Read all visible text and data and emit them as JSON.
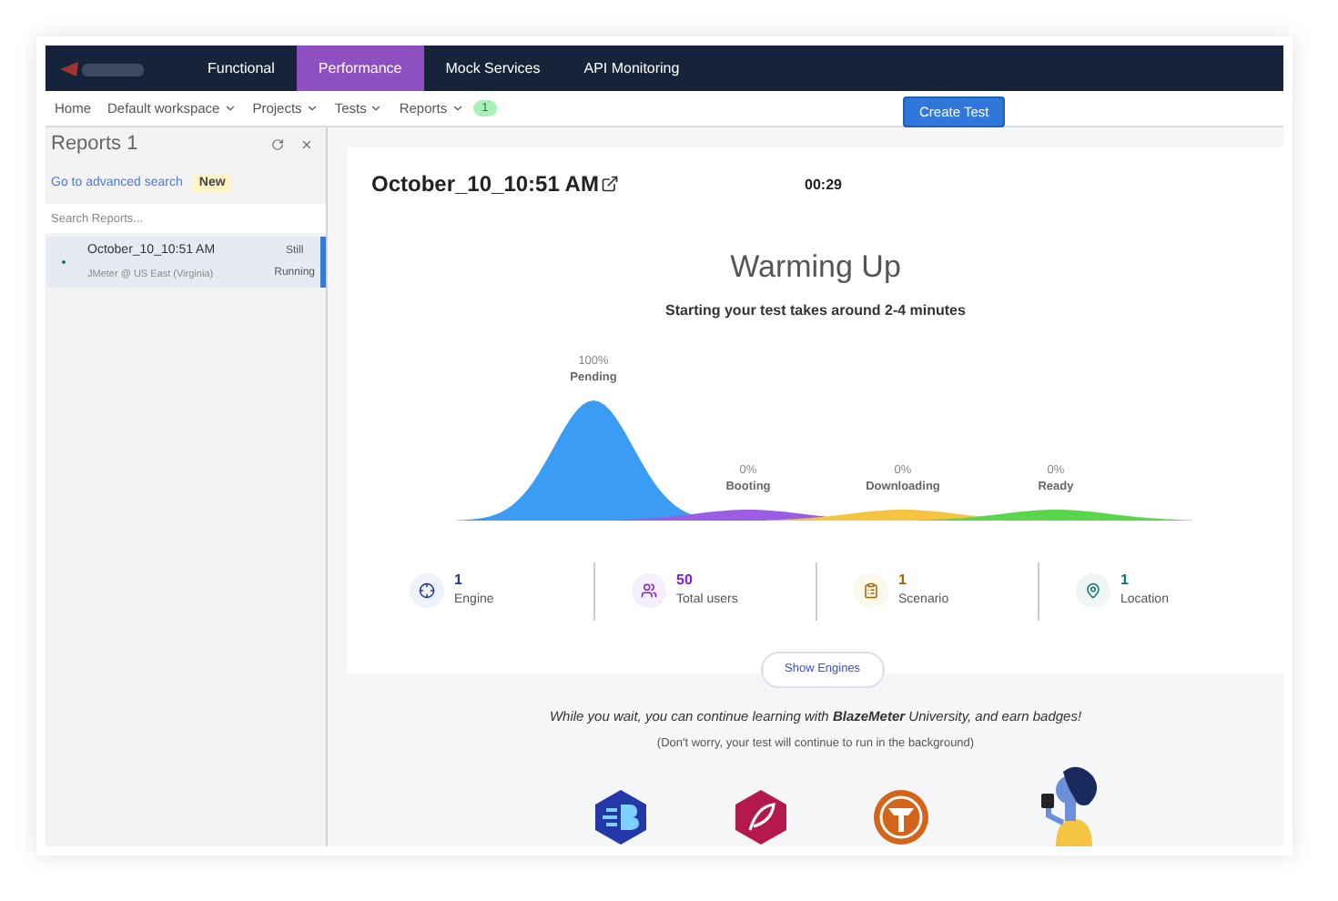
{
  "nav": {
    "tabs": [
      {
        "label": "Functional",
        "selected": false
      },
      {
        "label": "Performance",
        "selected": true
      },
      {
        "label": "Mock Services",
        "selected": false
      },
      {
        "label": "API Monitoring",
        "selected": false
      }
    ]
  },
  "subnav": {
    "items": [
      {
        "label": "Home",
        "dropdown": false
      },
      {
        "label": "Default workspace",
        "dropdown": true
      },
      {
        "label": "Projects",
        "dropdown": true
      },
      {
        "label": "Tests",
        "dropdown": true
      },
      {
        "label": "Reports",
        "dropdown": true
      }
    ],
    "count": "1",
    "create_button": "Create Test"
  },
  "sidebar": {
    "title": "Reports 1",
    "advanced_search": "Go to advanced search",
    "new_badge": "New",
    "search": {
      "placeholder": "Search Reports..."
    },
    "reports": [
      {
        "name": "October_10_10:51 AM",
        "subtitle": "JMeter @ US East (Virginia)",
        "status_1": "Still",
        "status_2": "Running",
        "selected": true
      }
    ]
  },
  "main": {
    "title": "October_10_10:51 AM",
    "timer": "00:29",
    "heading": "Warming Up",
    "subheading": "Starting your test takes around 2-4 minutes",
    "stages": [
      {
        "percent": "100%",
        "label": "Pending",
        "color": "#3b9cf5"
      },
      {
        "percent": "0%",
        "label": "Booting",
        "color": "#9b5de5"
      },
      {
        "percent": "0%",
        "label": "Downloading",
        "color": "#f5c542"
      },
      {
        "percent": "0%",
        "label": "Ready",
        "color": "#5ad64a"
      }
    ],
    "stats": [
      {
        "kind": "engine",
        "value": "1",
        "label": "Engine",
        "color": "#1e3a8a"
      },
      {
        "kind": "users",
        "value": "50",
        "label": "Total users",
        "color": "#7e22ce"
      },
      {
        "kind": "scenario",
        "value": "1",
        "label": "Scenario",
        "color": "#a16207"
      },
      {
        "kind": "location",
        "value": "1",
        "label": "Location",
        "color": "#0f766e"
      }
    ],
    "show_engines": "Show Engines"
  },
  "promo": {
    "text": "While you wait, you can continue learning with **BlazeMeter** University, and earn badges!",
    "note": "(Don't worry, your test will continue to run in the background)"
  }
}
